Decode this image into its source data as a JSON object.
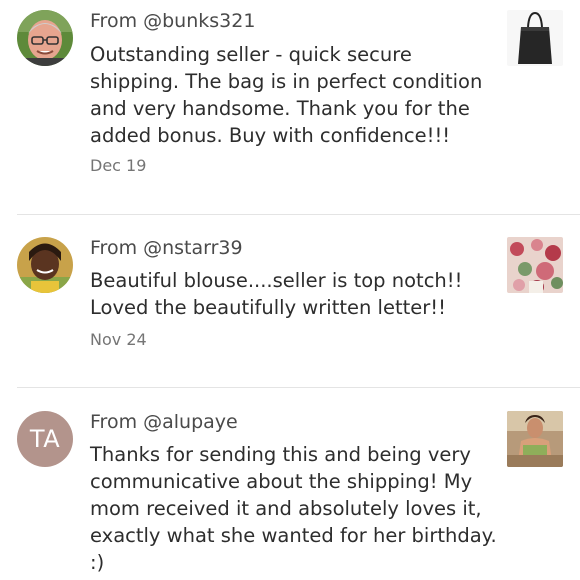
{
  "reviews": [
    {
      "from": "From @bunks321",
      "lines": [
        "Outstanding seller - quick secure",
        "shipping. The bag is in perfect condition",
        "and very handsome. Thank you for the",
        "added bonus. Buy with confidence!!!"
      ],
      "date": "Dec 19"
    },
    {
      "from": "From @nstarr39",
      "lines": [
        "Beautiful blouse....seller is top notch!!",
        "Loved the beautifully written letter!!"
      ],
      "date": "Nov 24"
    },
    {
      "from": "From @alupaye",
      "initials": "TA",
      "lines": [
        "Thanks for sending this and being very",
        "communicative about the shipping! My",
        "mom received it and absolutely loves it,",
        "exactly what she wanted for her birthday.",
        ":)"
      ]
    }
  ],
  "colors": {
    "initials_avatar_bg": "#b3948c",
    "divider": "#e4e4e4",
    "date_text": "#757575"
  }
}
